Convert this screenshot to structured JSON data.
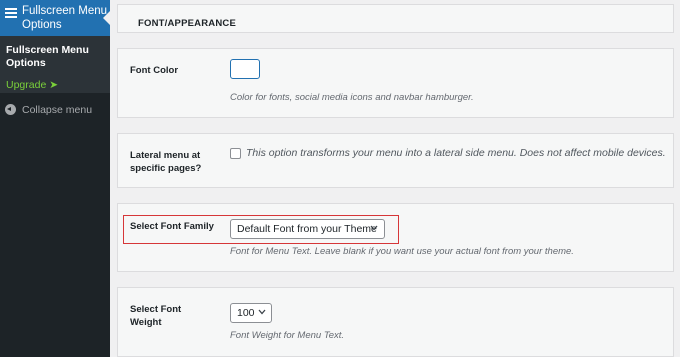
{
  "sidebar": {
    "menu_title": "Fullscreen Menu Options",
    "submenu": {
      "current": "Fullscreen Menu Options",
      "upgrade": "Upgrade ➤"
    },
    "collapse": "Collapse menu"
  },
  "colors": {
    "sidebar_bg": "#1d2327",
    "active_menu": "#2271b1",
    "upgrade_link": "#7ad03a",
    "highlight_box": "#d63638"
  },
  "section": {
    "title": "FONT/APPEARANCE"
  },
  "font_color": {
    "label": "Font Color",
    "swatch_color": "#ffffff",
    "description": "Color for fonts, social media icons and navbar hamburger."
  },
  "lateral_menu": {
    "label": "Lateral menu at specific pages?",
    "checked": false,
    "checkbox_text": "This option transforms your menu into a lateral side menu. Does not affect mobile devices."
  },
  "font_family": {
    "label": "Select Font Family",
    "value": "Default Font from your Theme",
    "description": "Font for Menu Text. Leave blank if you want use your actual font from your theme."
  },
  "font_weight": {
    "label": "Select Font Weight",
    "value": "100",
    "description": "Font Weight for Menu Text."
  }
}
